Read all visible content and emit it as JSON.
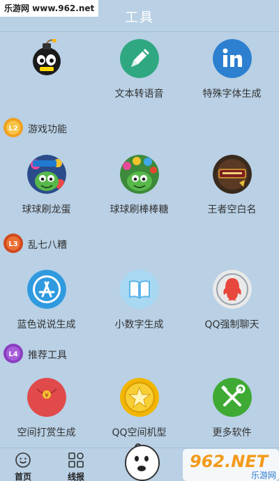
{
  "watermark": "乐游网 www.962.net",
  "header": {
    "title": "工具"
  },
  "rows": [
    [
      {
        "label": "",
        "icon": "bomb-icon"
      },
      {
        "label": "文本转语音",
        "icon": "pencil-icon"
      },
      {
        "label": "特殊字体生成",
        "icon": "linkedin-icon"
      }
    ],
    [
      {
        "label": "球球刷龙蛋",
        "icon": "game-monster-icon"
      },
      {
        "label": "球球刷棒棒糖",
        "icon": "game-monster-candy-icon"
      },
      {
        "label": "王者空白名",
        "icon": "king-glory-icon"
      }
    ],
    [
      {
        "label": "蓝色说说生成",
        "icon": "app-store-icon"
      },
      {
        "label": "小数字生成",
        "icon": "book-icon"
      },
      {
        "label": "QQ强制聊天",
        "icon": "qq-penguin-icon"
      }
    ],
    [
      {
        "label": "空间打赏生成",
        "icon": "red-envelope-icon"
      },
      {
        "label": "QQ空间机型",
        "icon": "gold-coin-star-icon"
      },
      {
        "label": "更多软件",
        "icon": "tools-icon"
      }
    ]
  ],
  "sections": [
    {
      "title": "游戏功能",
      "badge": "L2"
    },
    {
      "title": "乱七八糟",
      "badge": "L3"
    },
    {
      "title": "推荐工具",
      "badge": "L4"
    }
  ],
  "tabbar": {
    "tabs": [
      {
        "label": "首页",
        "icon": "smiley-icon"
      },
      {
        "label": "线报",
        "icon": "grid-icon"
      }
    ]
  },
  "watermark_br": {
    "text": "962.NET",
    "sub": "乐游网"
  },
  "colors": {
    "background": "#b9d0e5",
    "pencil_green": "#2fa882",
    "linkedin_blue": "#2d7fd0",
    "appstore_blue": "#2f9ae0",
    "book_blue": "#5db5e8",
    "qq_red": "#e8473d",
    "envelope_red": "#e14a4a",
    "coin_gold": "#f2b600",
    "tools_green": "#3eaa34"
  }
}
